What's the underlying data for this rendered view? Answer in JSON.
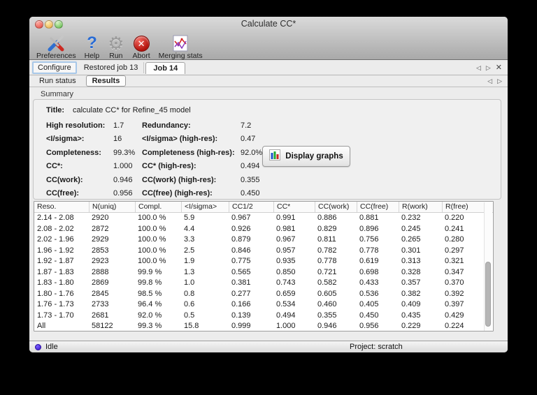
{
  "window": {
    "title": "Calculate CC*"
  },
  "toolbar": {
    "items": [
      {
        "label": "Preferences",
        "icon": "tools-icon"
      },
      {
        "label": "Help",
        "icon": "help-icon"
      },
      {
        "label": "Run",
        "icon": "gear-icon"
      },
      {
        "label": "Abort",
        "icon": "abort-icon"
      },
      {
        "label": "Merging stats",
        "icon": "merging-stats-icon"
      }
    ]
  },
  "nav": {
    "prev": "◁",
    "next": "▷",
    "close": "✕",
    "abort_glyph": "✕"
  },
  "tabs": {
    "job_tabs": [
      {
        "label": "Configure"
      },
      {
        "label": "Restored job 13"
      },
      {
        "label": "Job 14"
      }
    ],
    "subtabs": [
      {
        "label": "Run status"
      },
      {
        "label": "Results"
      }
    ]
  },
  "summary": {
    "group_label": "Summary",
    "title_label": "Title:",
    "title_value": "calculate CC* for Refine_45 model",
    "rows": [
      {
        "label1": "High resolution:",
        "value1": "1.7",
        "label2": "Redundancy:",
        "value2": "7.2"
      },
      {
        "label1": "<I/sigma>:",
        "value1": "16",
        "label2": "<I/sigma> (high-res):",
        "value2": "0.47"
      },
      {
        "label1": "Completeness:",
        "value1": "99.3%",
        "label2": "Completeness (high-res):",
        "value2": "92.0%"
      },
      {
        "label1": "CC*:",
        "value1": "1.000",
        "label2": "CC* (high-res):",
        "value2": "0.494"
      },
      {
        "label1": "CC(work):",
        "value1": "0.946",
        "label2": "CC(work) (high-res):",
        "value2": "0.355"
      },
      {
        "label1": "CC(free):",
        "value1": "0.956",
        "label2": "CC(free) (high-res):",
        "value2": "0.450"
      }
    ],
    "display_graphs_label": "Display graphs"
  },
  "results_table": {
    "columns": [
      "Reso.",
      "N(uniq)",
      "Compl.",
      "<I/sigma>",
      "CC1/2",
      "CC*",
      "CC(work)",
      "CC(free)",
      "R(work)",
      "R(free)"
    ],
    "rows": [
      [
        "2.14 - 2.08",
        "2920",
        "100.0 %",
        "5.9",
        "0.967",
        "0.991",
        "0.886",
        "0.881",
        "0.232",
        "0.220"
      ],
      [
        "2.08 - 2.02",
        "2872",
        "100.0 %",
        "4.4",
        "0.926",
        "0.981",
        "0.829",
        "0.896",
        "0.245",
        "0.241"
      ],
      [
        "2.02 - 1.96",
        "2929",
        "100.0 %",
        "3.3",
        "0.879",
        "0.967",
        "0.811",
        "0.756",
        "0.265",
        "0.280"
      ],
      [
        "1.96 - 1.92",
        "2853",
        "100.0 %",
        "2.5",
        "0.846",
        "0.957",
        "0.782",
        "0.778",
        "0.301",
        "0.297"
      ],
      [
        "1.92 - 1.87",
        "2923",
        "100.0 %",
        "1.9",
        "0.775",
        "0.935",
        "0.778",
        "0.619",
        "0.313",
        "0.321"
      ],
      [
        "1.87 - 1.83",
        "2888",
        "99.9 %",
        "1.3",
        "0.565",
        "0.850",
        "0.721",
        "0.698",
        "0.328",
        "0.347"
      ],
      [
        "1.83 - 1.80",
        "2869",
        "99.8 %",
        "1.0",
        "0.381",
        "0.743",
        "0.582",
        "0.433",
        "0.357",
        "0.370"
      ],
      [
        "1.80 - 1.76",
        "2845",
        "98.5 %",
        "0.8",
        "0.277",
        "0.659",
        "0.605",
        "0.536",
        "0.382",
        "0.392"
      ],
      [
        "1.76 - 1.73",
        "2733",
        "96.4 %",
        "0.6",
        "0.166",
        "0.534",
        "0.460",
        "0.405",
        "0.409",
        "0.397"
      ],
      [
        "1.73 - 1.70",
        "2681",
        "92.0 %",
        "0.5",
        "0.139",
        "0.494",
        "0.355",
        "0.450",
        "0.435",
        "0.429"
      ],
      [
        "All",
        "58122",
        "99.3 %",
        "15.8",
        "0.999",
        "1.000",
        "0.946",
        "0.956",
        "0.229",
        "0.224"
      ]
    ]
  },
  "statusbar": {
    "status": "Idle",
    "project": "Project: scratch"
  },
  "colors": {
    "accent_blue": "#2a6cd4",
    "abort_red": "#b2120c",
    "status_dot": "#3912c9"
  }
}
